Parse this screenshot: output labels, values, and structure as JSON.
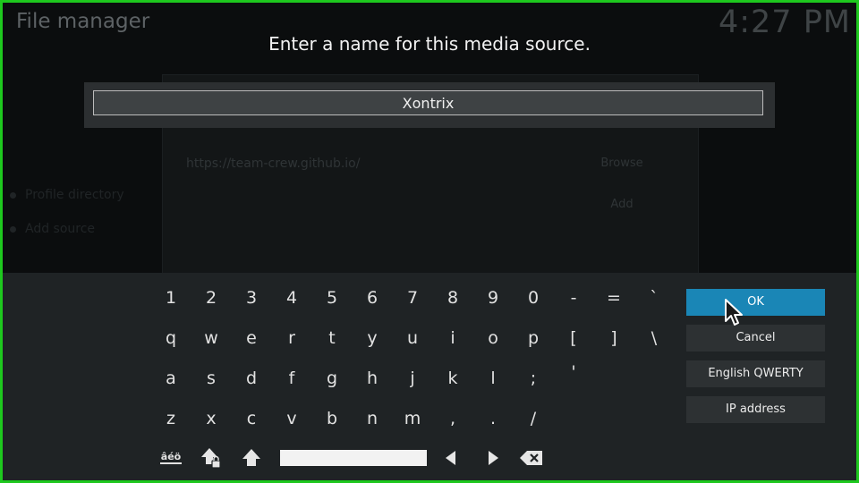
{
  "window": {
    "title": "File manager",
    "clock": "4:27 PM"
  },
  "background": {
    "source_url": "https://team-crew.github.io/",
    "browse_label": "Browse",
    "add_label": "Add",
    "list_items": [
      "Profile directory",
      "Add source"
    ]
  },
  "dialog": {
    "heading": "Enter a name for this media source.",
    "input_value": "Xontrix"
  },
  "keyboard": {
    "rows": [
      [
        "1",
        "2",
        "3",
        "4",
        "5",
        "6",
        "7",
        "8",
        "9",
        "0",
        "-",
        "=",
        "`"
      ],
      [
        "q",
        "w",
        "e",
        "r",
        "t",
        "y",
        "u",
        "i",
        "o",
        "p",
        "[",
        "]",
        "\\"
      ],
      [
        "a",
        "s",
        "d",
        "f",
        "g",
        "h",
        "j",
        "k",
        "l",
        ";",
        "'"
      ],
      [
        "z",
        "x",
        "c",
        "v",
        "b",
        "n",
        "m",
        ",",
        ".",
        "/"
      ]
    ],
    "symbols_label": "âéö"
  },
  "buttons": {
    "ok": "OK",
    "cancel": "Cancel",
    "layout": "English QWERTY",
    "ip_address": "IP address"
  },
  "colors": {
    "focus": "#1a86b6",
    "frame_border": "#1ec81e"
  }
}
